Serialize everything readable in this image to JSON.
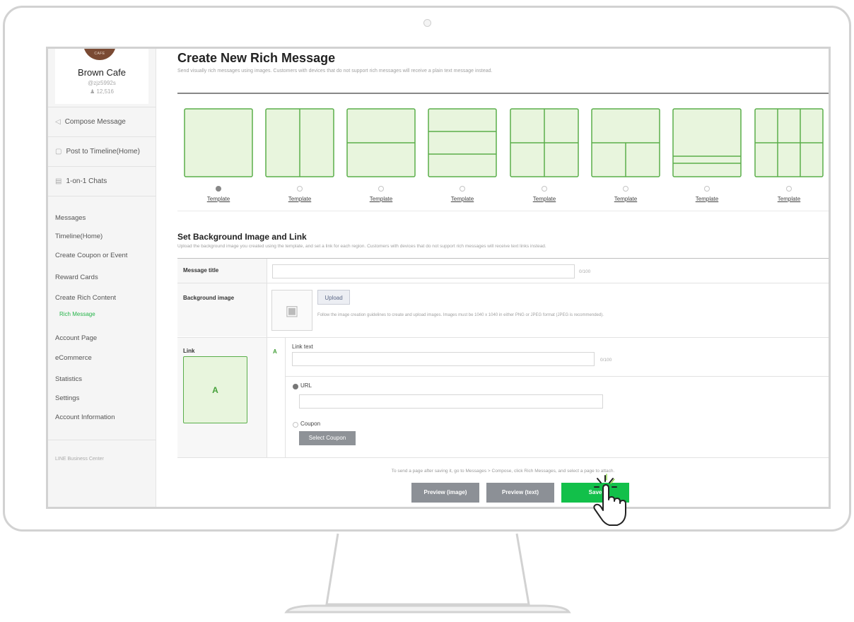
{
  "sidebar": {
    "logo_text": "CAFE",
    "shop_name": "Brown Cafe",
    "shop_id": "@zjz5992s",
    "friends": "12,516",
    "actions": [
      {
        "label": "Compose Message",
        "icon": "speaker-icon"
      },
      {
        "label": "Post to Timeline(Home)",
        "icon": "post-icon"
      },
      {
        "label": "1-on-1 Chats",
        "icon": "chat-icon"
      }
    ],
    "links": [
      "Messages",
      "Timeline(Home)",
      "Create Coupon or Event",
      "Reward Cards",
      "Create Rich Content"
    ],
    "active_sub": "Rich Message",
    "links2": [
      "Account Page",
      "eCommerce",
      "Statistics",
      "Settings",
      "Account Information"
    ],
    "footer": "LINE Business Center"
  },
  "main": {
    "title": "Create New Rich Message",
    "description": "Send visually rich messages using images. Customers with devices that do not support rich messages will receive a plain text message instead.",
    "template_label": "Template",
    "selected_template": 0,
    "template_count": 8,
    "section_title": "Set Background Image and Link",
    "section_desc": "Upload the background image you created using the template, and set a link for each region. Customers with devices that do not support rich messages will receive text links instead.",
    "form": {
      "message_title_label": "Message title",
      "message_title_value": "",
      "message_title_counter": "0/100",
      "background_label": "Background image",
      "upload_label": "Upload",
      "upload_note": "Follow the image creation guidelines to create and upload images. Images must be 1040 x 1040 in either PNG or JPEG format (JPEG is recommended).",
      "link_label": "Link",
      "region_letter": "A",
      "link_text_label": "Link text",
      "link_text_counter": "0/100",
      "url_label": "URL",
      "coupon_label": "Coupon",
      "select_coupon_label": "Select Coupon"
    },
    "footnote": "To send a page after saving it, go to Messages > Compose, click Rich Messages, and select a page to attach.",
    "buttons": {
      "preview_image": "Preview (image)",
      "preview_text": "Preview (text)",
      "save": "Save"
    }
  },
  "colors": {
    "accent_green": "#12c04a",
    "template_fill": "#e8f5dd",
    "template_stroke": "#5aae4a",
    "sidebar_bg": "#f5f5f5"
  }
}
